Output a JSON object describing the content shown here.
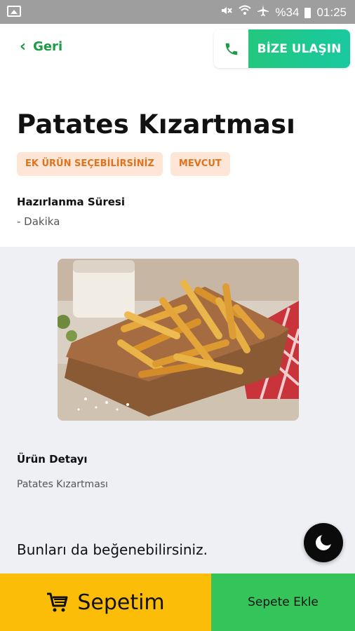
{
  "status_bar": {
    "battery": "%34",
    "time": "01:25",
    "icons": [
      "image-icon",
      "mute-icon",
      "wifi-icon",
      "airplane-icon",
      "battery-icon"
    ]
  },
  "header": {
    "back_label": "Geri",
    "contact_label": "BİZE ULAŞIN",
    "contact_icon": "phone-icon"
  },
  "product": {
    "title": "Patates Kızartması",
    "tags": [
      "EK ÜRÜN SEÇEBİLİRSİNİZ",
      "MEVCUT"
    ],
    "prep_label": "Hazırlanma Süresi",
    "prep_value": "- Dakika",
    "detail_label": "Ürün Detayı",
    "detail_value": "Patates Kızartması"
  },
  "recommend_label": "Bunları da beğenebilirsiniz.",
  "bottom_bar": {
    "cart_label": "Sepetim",
    "add_label": "Sepete Ekle"
  },
  "colors": {
    "accent_green": "#1e9b45",
    "contact_gradient": "#23c77e",
    "tag_bg": "#fde6d6",
    "tag_text": "#e0731f",
    "cart_yellow": "#fbbd08",
    "add_green": "#34c45a"
  }
}
